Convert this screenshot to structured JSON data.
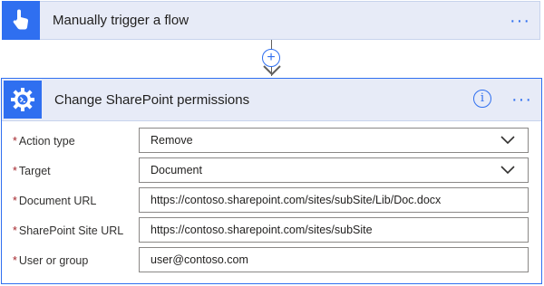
{
  "trigger": {
    "title": "Manually trigger a flow",
    "icon": "touch-hand-icon",
    "menu": "···"
  },
  "connector": {
    "add_symbol": "+"
  },
  "action": {
    "title": "Change SharePoint permissions",
    "icon": "gear-terminal-icon",
    "info_symbol": "i",
    "menu": "···",
    "fields": [
      {
        "label": "Action type",
        "required": "*",
        "value": "Remove",
        "kind": "dropdown"
      },
      {
        "label": "Target",
        "required": "*",
        "value": "Document",
        "kind": "dropdown"
      },
      {
        "label": "Document URL",
        "required": "*",
        "value": "https://contoso.sharepoint.com/sites/subSite/Lib/Doc.docx",
        "kind": "text"
      },
      {
        "label": "SharePoint Site URL",
        "required": "*",
        "value": "https://contoso.sharepoint.com/sites/subSite",
        "kind": "text"
      },
      {
        "label": "User or group",
        "required": "*",
        "value": "user@contoso.com",
        "kind": "text"
      }
    ]
  },
  "colors": {
    "accent": "#2f6ff0",
    "header_bg": "#e7ebf7",
    "required": "#a4262c"
  }
}
